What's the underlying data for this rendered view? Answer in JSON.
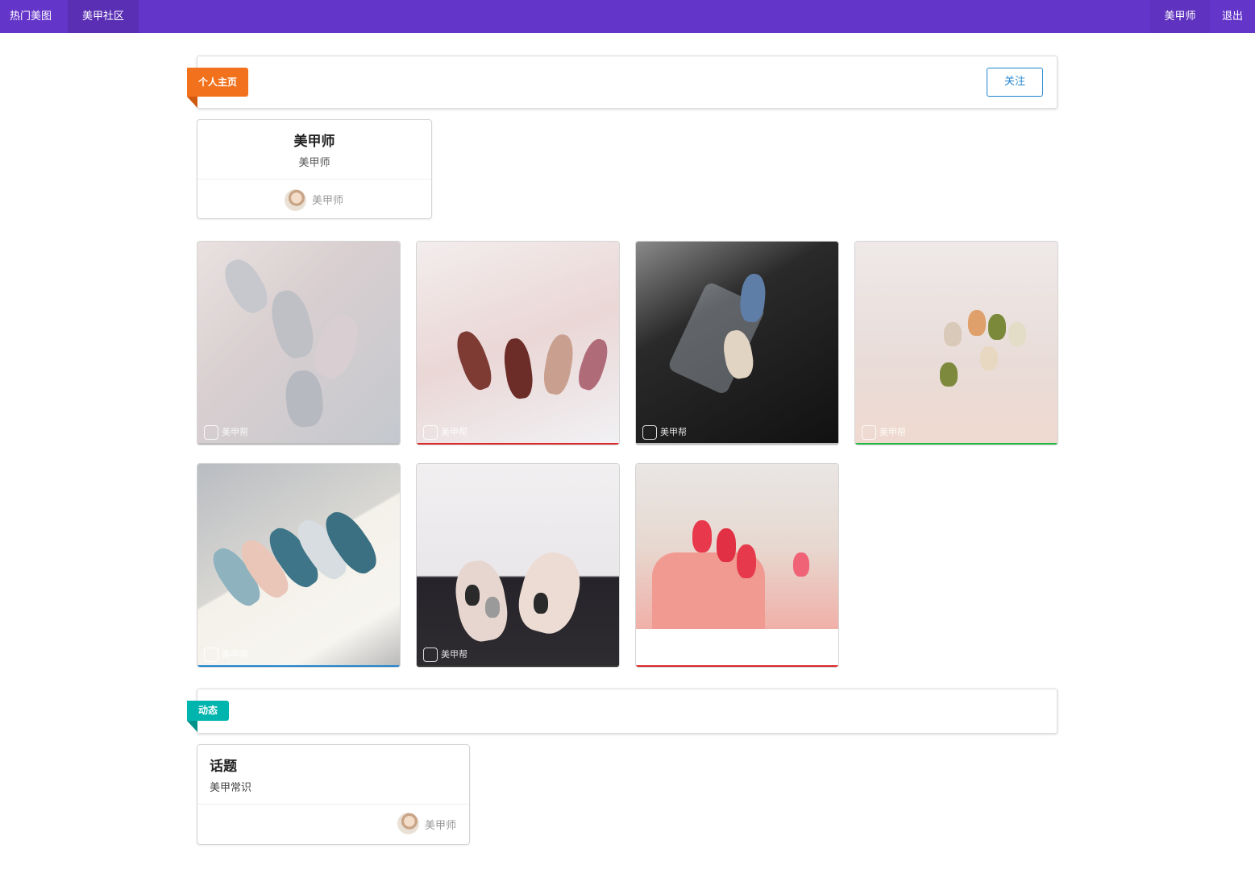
{
  "nav": {
    "left": [
      "热门美图",
      "美甲社区"
    ],
    "right": [
      "美甲师",
      "退出"
    ]
  },
  "profile_section": {
    "ribbon": "个人主页",
    "follow_label": "关注",
    "card": {
      "name": "美甲师",
      "role": "美甲师",
      "author": "美甲师"
    }
  },
  "gallery": [
    {
      "watermark": "美甲帮",
      "accent": "#bdbdbd"
    },
    {
      "watermark": "美甲帮",
      "accent": "#db2828"
    },
    {
      "watermark": "美甲帮",
      "accent": "#bdbdbd"
    },
    {
      "watermark": "美甲帮",
      "accent": "#21ba45"
    },
    {
      "watermark": "美甲帮",
      "accent": "#2185d0"
    },
    {
      "watermark": "美甲帮",
      "accent": "#333333"
    },
    {
      "watermark": "",
      "accent": "#db2828"
    }
  ],
  "activity_section": {
    "ribbon": "动态",
    "topic": {
      "title": "话题",
      "subtitle": "美甲常识",
      "author": "美甲师"
    }
  }
}
